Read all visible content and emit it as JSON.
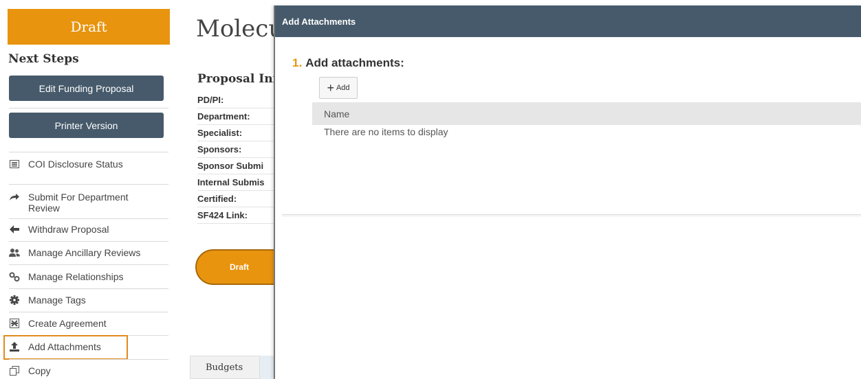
{
  "sidebar": {
    "status": "Draft",
    "next_steps_heading": "Next Steps",
    "buttons": {
      "edit_funding_proposal": "Edit Funding Proposal",
      "printer_version": "Printer Version"
    },
    "actions": [
      {
        "label": "COI Disclosure Status",
        "icon": "list-icon"
      },
      {
        "label": "Submit For Department Review",
        "icon": "share-arrow-icon"
      },
      {
        "label": "Withdraw Proposal",
        "icon": "arrow-left-icon"
      },
      {
        "label": "Manage Ancillary Reviews",
        "icon": "users-icon"
      },
      {
        "label": "Manage Relationships",
        "icon": "relationship-icon"
      },
      {
        "label": "Manage Tags",
        "icon": "gear-icon"
      },
      {
        "label": "Create Agreement",
        "icon": "agreement-icon"
      },
      {
        "label": "Add Attachments",
        "icon": "upload-icon"
      },
      {
        "label": "Copy",
        "icon": "copy-icon"
      }
    ],
    "highlight_color": "#e08a1c"
  },
  "page": {
    "title": "Molecu",
    "section_title": "Proposal Info",
    "fields": [
      "PD/PI:",
      "Department:",
      "Specialist:",
      "Sponsors:",
      "Sponsor Submi",
      "Internal Submis",
      "Certified:",
      "SF424 Link:"
    ],
    "status_pill": "Draft",
    "tabs": [
      "Budgets"
    ]
  },
  "modal": {
    "title": "Add Attachments",
    "step_number": "1.",
    "step_label": "Add attachments:",
    "add_button_label": "Add",
    "table": {
      "columns": [
        "Name"
      ],
      "empty_message": "There are no items to display"
    }
  },
  "colors": {
    "accent_orange": "#e8940f",
    "header_slate": "#465a6b"
  }
}
